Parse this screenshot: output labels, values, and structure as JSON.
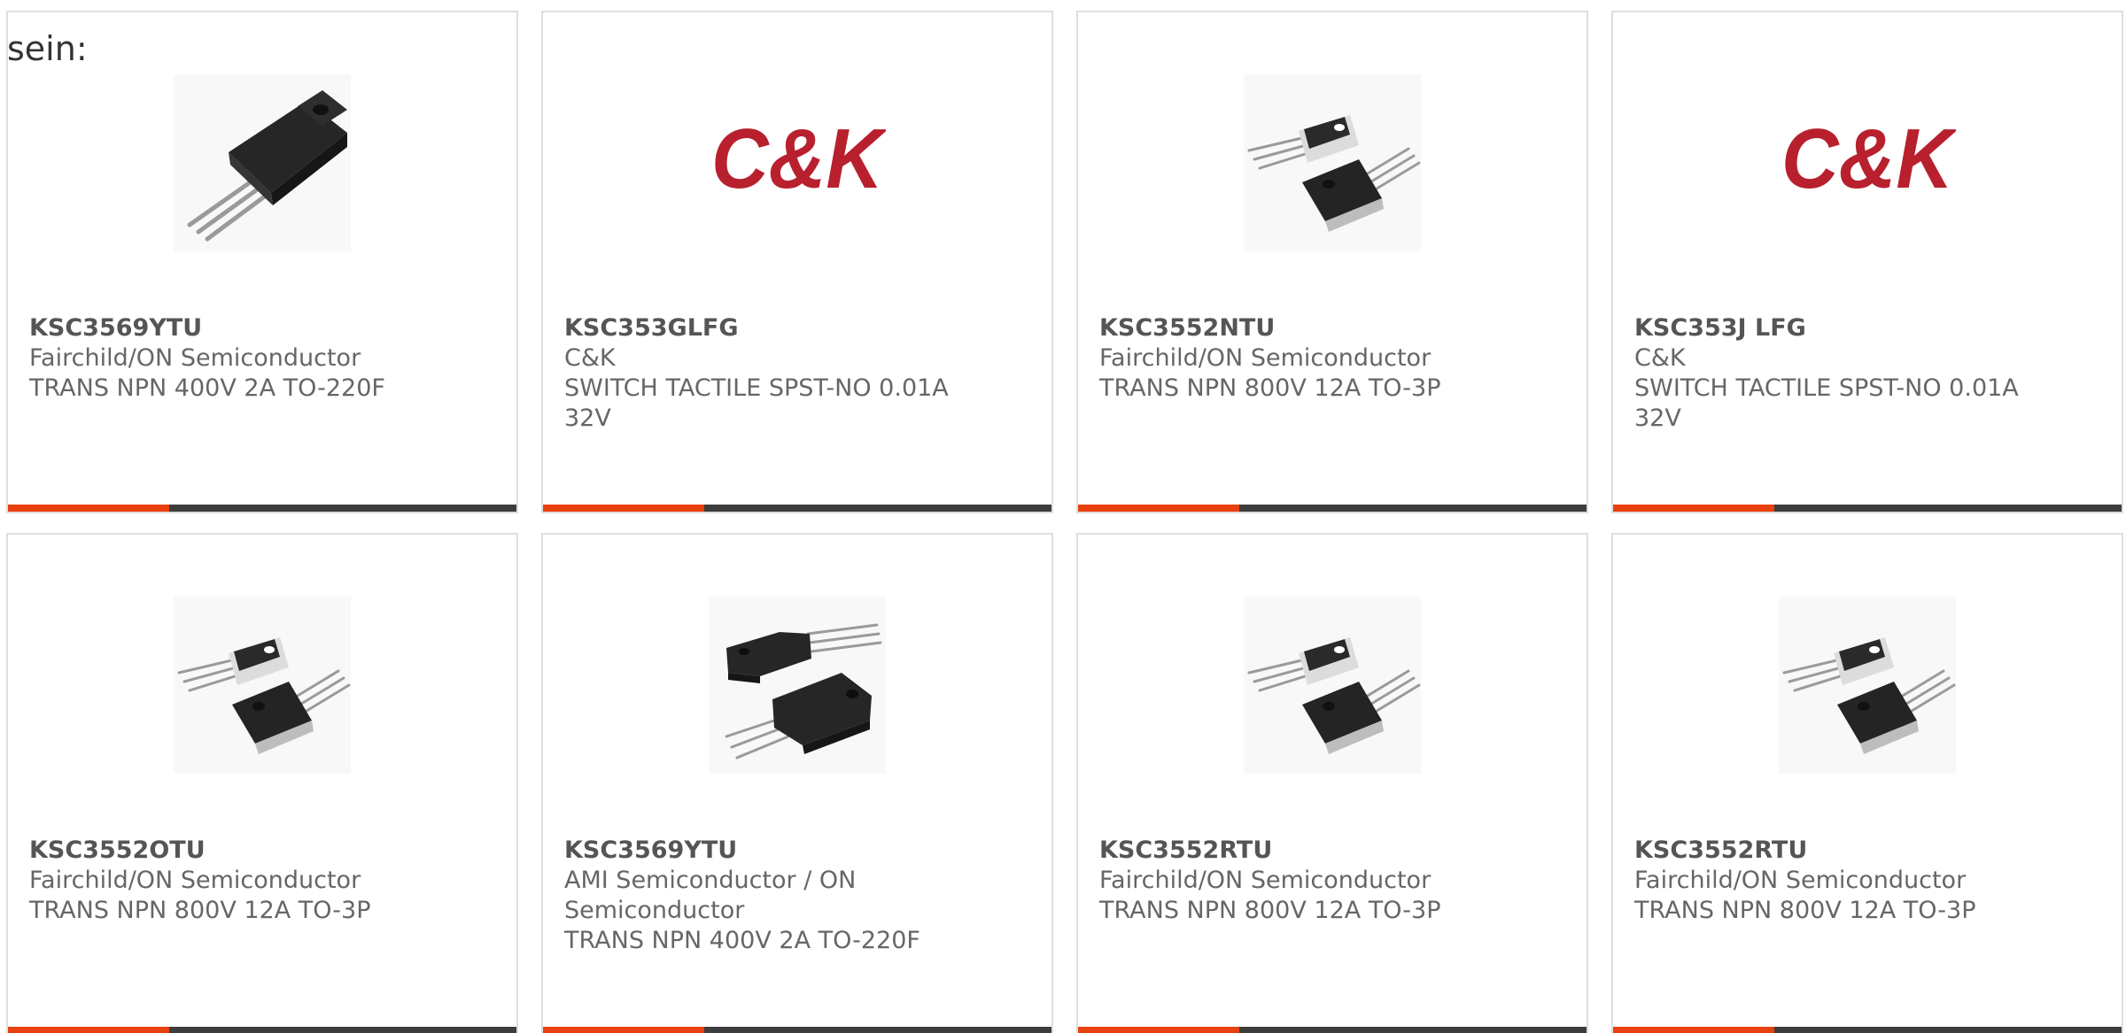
{
  "lead_text": "sein:",
  "colors": {
    "accent": "#e8410f",
    "bar": "#3d3d3d",
    "card_border": "#dedede",
    "text": "#666666",
    "logo_red": "#b8202e"
  },
  "products": [
    {
      "part_number": "KSC3569YTU",
      "manufacturer": "Fairchild/ON Semiconductor",
      "description": "TRANS NPN 400V 2A TO-220F",
      "image": "to220f-transistor-image"
    },
    {
      "part_number": "KSC353GLFG",
      "manufacturer": "C&K",
      "description": "SWITCH TACTILE SPST-NO 0.01A 32V",
      "image": "ck-logo",
      "logo_text": "C&K"
    },
    {
      "part_number": "KSC3552NTU",
      "manufacturer": "Fairchild/ON Semiconductor",
      "description": "TRANS NPN 800V 12A TO-3P",
      "image": "to3p-transistor-image"
    },
    {
      "part_number": "KSC353J LFG",
      "manufacturer": "C&K",
      "description": "SWITCH TACTILE SPST-NO 0.01A 32V",
      "image": "ck-logo",
      "logo_text": "C&K"
    },
    {
      "part_number": "KSC3552OTU",
      "manufacturer": "Fairchild/ON Semiconductor",
      "description": "TRANS NPN 800V 12A TO-3P",
      "image": "to3p-transistor-image"
    },
    {
      "part_number": "KSC3569YTU",
      "manufacturer": "AMI Semiconductor / ON Semiconductor",
      "description": "TRANS NPN 400V 2A TO-220F",
      "image": "to220f-pair-image"
    },
    {
      "part_number": "KSC3552RTU",
      "manufacturer": "Fairchild/ON Semiconductor",
      "description": "TRANS NPN 800V 12A TO-3P",
      "image": "to3p-transistor-image"
    },
    {
      "part_number": "KSC3552RTU",
      "manufacturer": "Fairchild/ON Semiconductor",
      "description": "TRANS NPN 800V 12A TO-3P",
      "image": "to3p-transistor-image"
    }
  ]
}
